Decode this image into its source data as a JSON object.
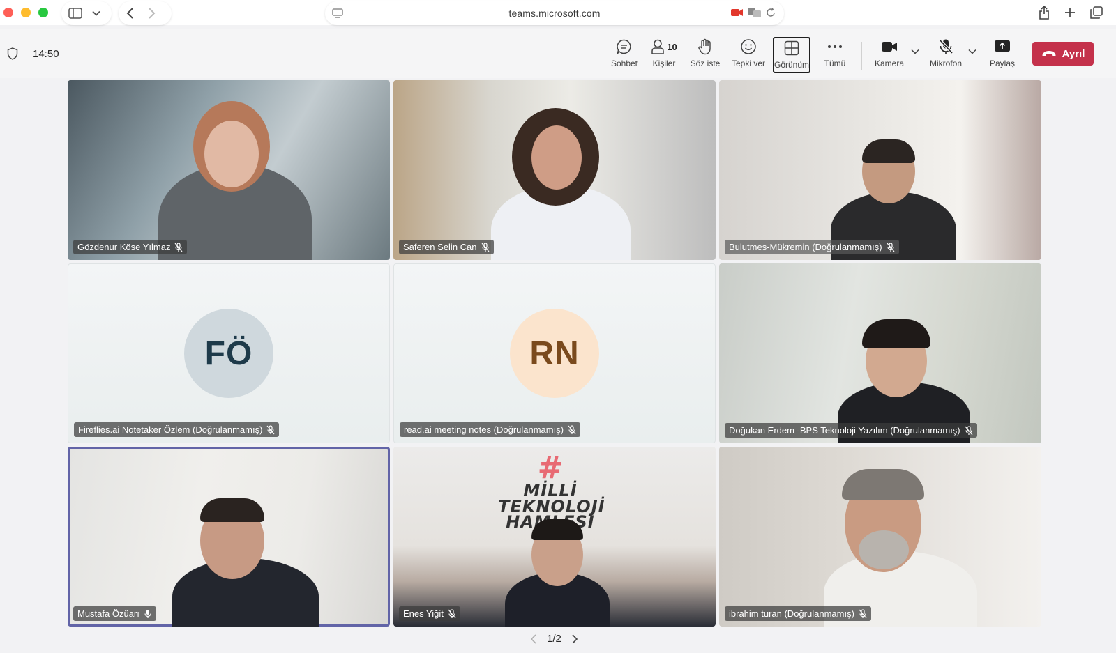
{
  "browser": {
    "url": "teams.microsoft.com"
  },
  "meeting": {
    "time": "14:50",
    "toolbar": {
      "chat_label": "Sohbet",
      "people_label": "Kişiler",
      "people_count": "10",
      "raise_hand_label": "Söz iste",
      "react_label": "Tepki ver",
      "view_label": "Görünüm",
      "more_label": "Tümü",
      "camera_label": "Kamera",
      "mic_label": "Mikrofon",
      "share_label": "Paylaş",
      "leave_label": "Ayrıl"
    }
  },
  "participants": [
    {
      "name": "Gözdenur Köse Yılmaz",
      "muted": true
    },
    {
      "name": "Saferen Selin Can",
      "muted": true
    },
    {
      "name": "Bulutmes-Mükremin (Doğrulanmamış)",
      "muted": true
    },
    {
      "name": "Fireflies.ai Notetaker Özlem (Doğrulanmamış)",
      "initials": "FÖ",
      "muted": true
    },
    {
      "name": "read.ai meeting notes (Doğrulanmamış)",
      "initials": "RN",
      "muted": true
    },
    {
      "name": "Doğukan Erdem -BPS Teknoloji Yazılım (Doğrulanmamış)",
      "muted": true
    },
    {
      "name": "Mustafa Özüarı",
      "muted": false,
      "speaking": true
    },
    {
      "name": "Enes Yiğit",
      "muted": true
    },
    {
      "name": "ibrahim turan (Doğrulanmamış)",
      "muted": true
    }
  ],
  "background_sign": {
    "line1": "#",
    "line2": "MİLLİ",
    "line3": "TEKNOLOJİ",
    "line4": "HAMLESİ"
  },
  "pager": {
    "label": "1/2"
  },
  "colors": {
    "leave": "#c4314b",
    "speaking_border": "#6264a7"
  }
}
